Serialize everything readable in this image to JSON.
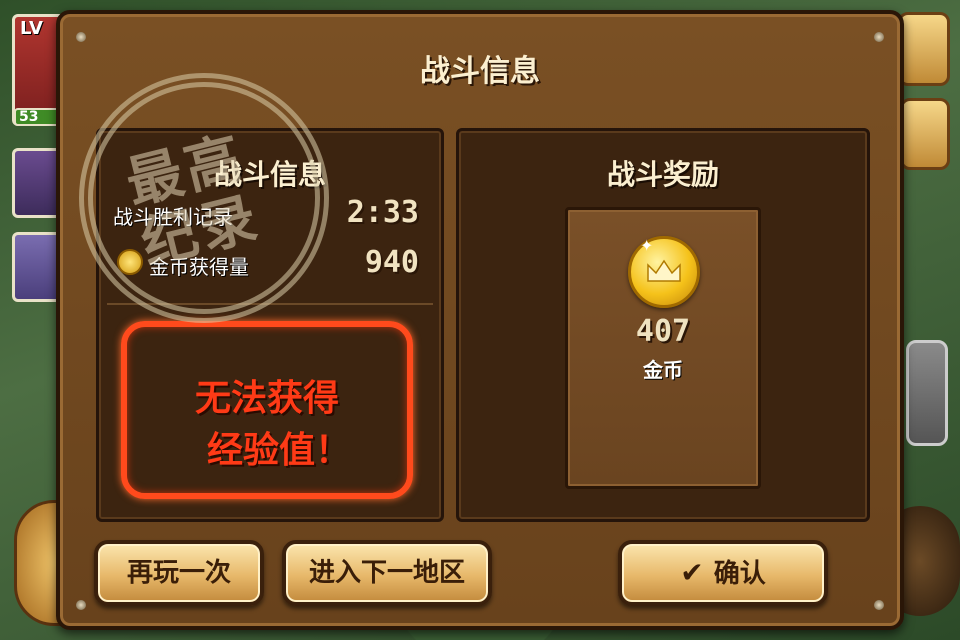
{
  "party": {
    "level_tag": "LV",
    "hp_value": "53"
  },
  "dialog": {
    "title": "战斗信息"
  },
  "stats": {
    "title": "战斗信息",
    "time_label": "战斗胜利记录",
    "time_value": "2:33",
    "coin_label": "金币获得量",
    "coin_value": "940",
    "stamp_text": "最高纪录"
  },
  "notice": {
    "line1": "无法获得",
    "line2": "经验值！"
  },
  "reward": {
    "title": "战斗奖励",
    "amount": "407",
    "name": "金币"
  },
  "buttons": {
    "replay": "再玩一次",
    "next_area": "进入下一地区",
    "confirm": "确认"
  },
  "icons": {
    "confirm": "check-icon",
    "coin": "gold-coin-icon",
    "crown": "crown-icon"
  }
}
